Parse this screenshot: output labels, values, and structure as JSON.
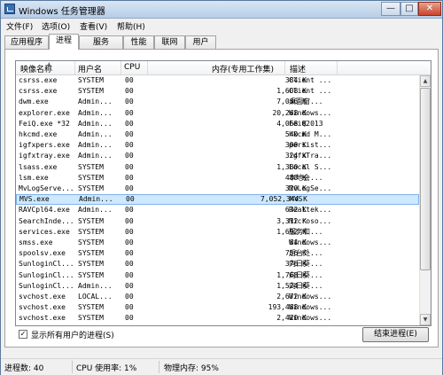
{
  "window": {
    "title": "Windows 任务管理器"
  },
  "controls": {
    "minimize": "—",
    "maximize": "□",
    "close": "✕"
  },
  "menu": [
    "文件(F)",
    "选项(O)",
    "查看(V)",
    "帮助(H)"
  ],
  "tabs": [
    "应用程序",
    "进程",
    "服务",
    "性能",
    "联网",
    "用户"
  ],
  "active_tab": "进程",
  "columns": {
    "name": "映像名称",
    "user": "用户名",
    "cpu": "CPU",
    "mem": "内存(专用工作集)",
    "desc": "描述"
  },
  "processes": [
    {
      "name": "csrss.exe",
      "user": "SYSTEM",
      "cpu": "00",
      "mem": "384 K",
      "desc": "Client ..."
    },
    {
      "name": "csrss.exe",
      "user": "SYSTEM",
      "cpu": "00",
      "mem": "1,608 K",
      "desc": "Client ..."
    },
    {
      "name": "dwm.exe",
      "user": "Admin...",
      "cpu": "00",
      "mem": "7,036 K",
      "desc": "桌面窗..."
    },
    {
      "name": "explorer.exe",
      "user": "Admin...",
      "cpu": "00",
      "mem": "20,268 K",
      "desc": "Windows..."
    },
    {
      "name": "FeiQ.exe *32",
      "user": "Admin...",
      "cpu": "00",
      "mem": "4,068 K",
      "desc": "FeiQ2013"
    },
    {
      "name": "hkcmd.exe",
      "user": "Admin...",
      "cpu": "00",
      "mem": "540 K",
      "desc": "hkcmd M..."
    },
    {
      "name": "igfxpers.exe",
      "user": "Admin...",
      "cpu": "00",
      "mem": "300 K",
      "desc": "persist..."
    },
    {
      "name": "igfxtray.exe",
      "user": "Admin...",
      "cpu": "00",
      "mem": "324 K",
      "desc": "igfxTra..."
    },
    {
      "name": "lsass.exe",
      "user": "SYSTEM",
      "cpu": "00",
      "mem": "1,380 K",
      "desc": "Local S..."
    },
    {
      "name": "lsm.exe",
      "user": "SYSTEM",
      "cpu": "00",
      "mem": "488 K",
      "desc": "本地会..."
    },
    {
      "name": "MvLogServe...",
      "user": "SYSTEM",
      "cpu": "00",
      "mem": "320 K",
      "desc": "MvLogSe..."
    },
    {
      "name": "MVS.exe",
      "user": "Admin...",
      "cpu": "00",
      "mem": "7,052,344 K",
      "desc": "MVS",
      "selected": true
    },
    {
      "name": "RAVCpl64.exe",
      "user": "Admin...",
      "cpu": "00",
      "mem": "632 K",
      "desc": "Realtek..."
    },
    {
      "name": "SearchInde...",
      "user": "SYSTEM",
      "cpu": "00",
      "mem": "3,312 K",
      "desc": "Microso..."
    },
    {
      "name": "services.exe",
      "user": "SYSTEM",
      "cpu": "00",
      "mem": "1,692 K",
      "desc": "服务和..."
    },
    {
      "name": "smss.exe",
      "user": "SYSTEM",
      "cpu": "00",
      "mem": "84 K",
      "desc": "Windows..."
    },
    {
      "name": "spoolsv.exe",
      "user": "SYSTEM",
      "cpu": "00",
      "mem": "756 K",
      "desc": "后台处..."
    },
    {
      "name": "SunloginCl...",
      "user": "SYSTEM",
      "cpu": "00",
      "mem": "376 K",
      "desc": "向日葵..."
    },
    {
      "name": "SunloginCl...",
      "user": "SYSTEM",
      "cpu": "00",
      "mem": "1,768 K",
      "desc": "向日葵..."
    },
    {
      "name": "SunloginCl...",
      "user": "Admin...",
      "cpu": "00",
      "mem": "1,524 K",
      "desc": "向日葵..."
    },
    {
      "name": "svchost.exe",
      "user": "LOCAL...",
      "cpu": "00",
      "mem": "2,672 K",
      "desc": "Windows..."
    },
    {
      "name": "svchost.exe",
      "user": "SYSTEM",
      "cpu": "00",
      "mem": "193,488 K",
      "desc": "Windows..."
    },
    {
      "name": "svchost.exe",
      "user": "SYSTEM",
      "cpu": "00",
      "mem": "2,420 K",
      "desc": "Windows..."
    }
  ],
  "show_all_users": {
    "label": "显示所有用户的进程(S)",
    "checked": true
  },
  "end_process_button": "结束进程(E)",
  "status": {
    "processes": "进程数: 40",
    "cpu": "CPU 使用率: 1%",
    "memory": "物理内存: 95%"
  },
  "colors": {
    "selection": "#cde8ff",
    "selection_border": "#7eb4ea",
    "titlebar": "#b7cde6"
  }
}
